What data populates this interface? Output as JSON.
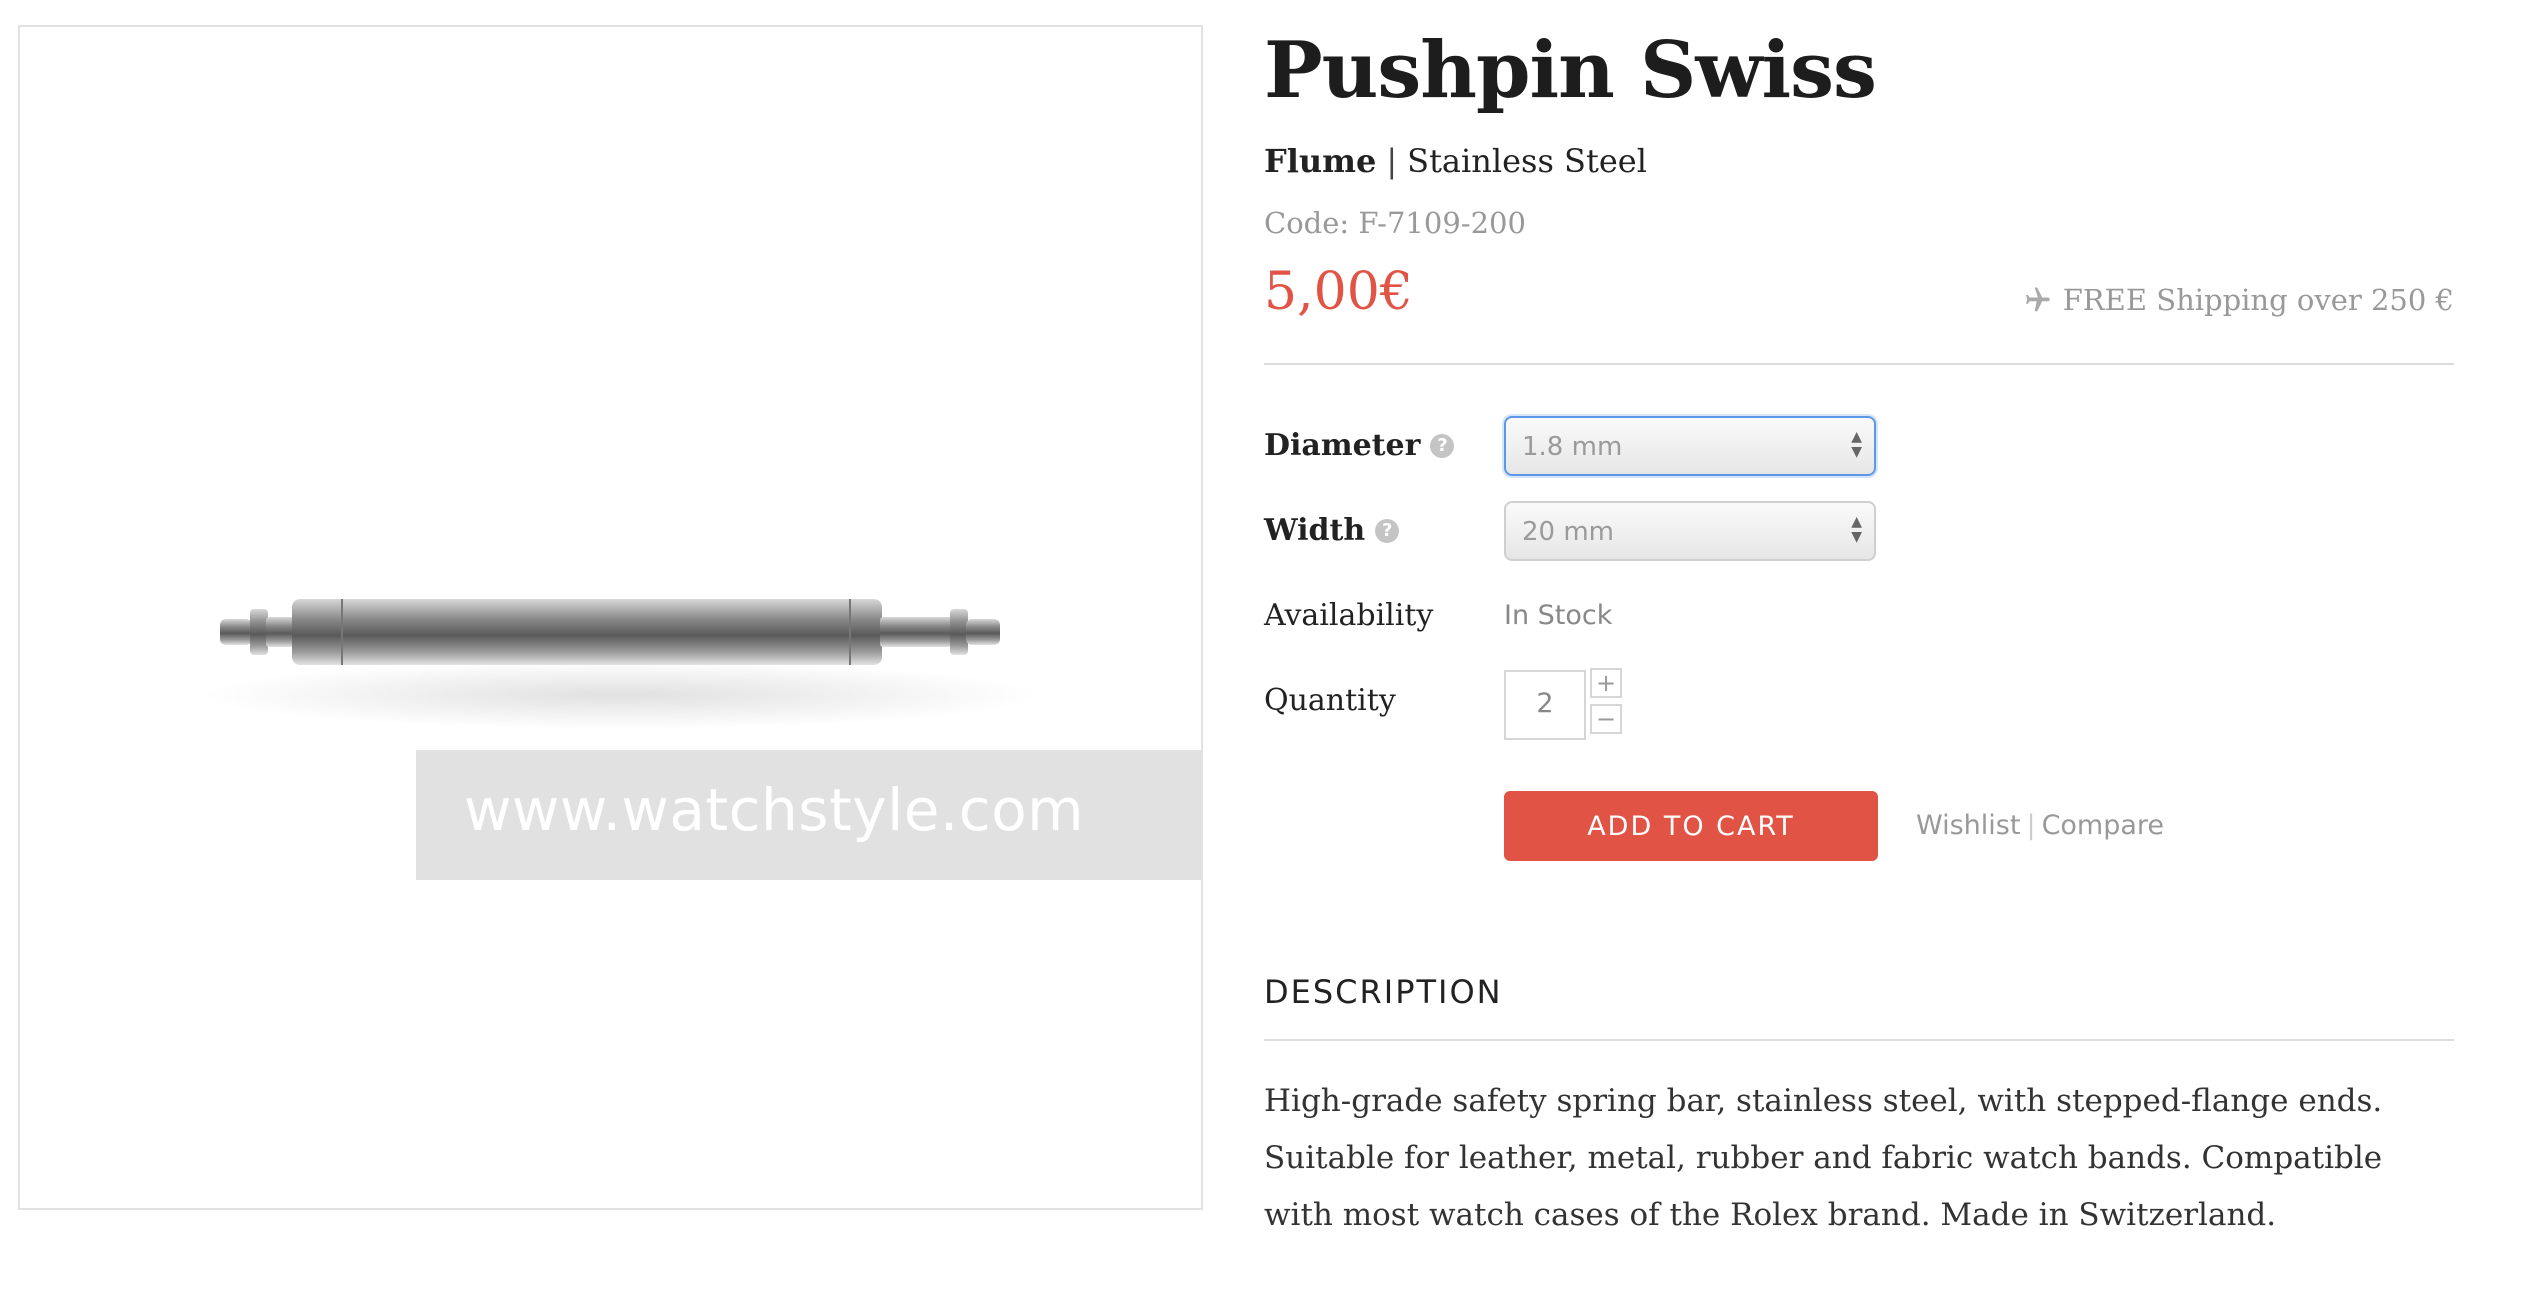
{
  "product": {
    "title": "Pushpin Swiss",
    "brand": "Flume",
    "separator": "|",
    "material": "Stainless Steel",
    "code": "Code: F-7109-200",
    "price": "5,00€",
    "shipping": "FREE Shipping over 250 €"
  },
  "image": {
    "watermark": "www.watchstyle.com"
  },
  "options": {
    "diameter_label": "Diameter",
    "diameter_value": "1.8 mm",
    "width_label": "Width",
    "width_value": "20 mm",
    "availability_label": "Availability",
    "availability_value": "In Stock",
    "quantity_label": "Quantity",
    "quantity_value": "2",
    "increment": "+",
    "decrement": "−"
  },
  "actions": {
    "add_to_cart": "ADD TO CART",
    "wishlist": "Wishlist",
    "separator": "|",
    "compare": "Compare"
  },
  "description": {
    "heading": "DESCRIPTION",
    "body": "High-grade safety spring bar, stainless steel, with stepped-flange ends. Suitable for leather, metal, rubber and fabric watch bands. Compatible with most watch cases of the Rolex brand. Made in Switzerland."
  },
  "colors": {
    "accent": "#e15445",
    "focus_border": "#5d98e6",
    "muted_text": "#999999",
    "divider": "#dcdcdc"
  },
  "icons": {
    "shipping": "airplane-icon",
    "help": "question-circle-icon",
    "select_arrows": "updown-arrows-icon"
  }
}
